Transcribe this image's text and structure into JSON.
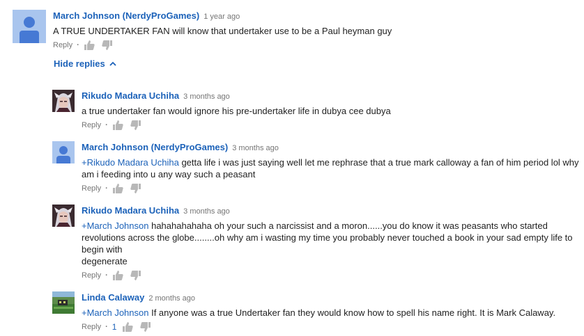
{
  "top_comment": {
    "author": "March Johnson (NerdyProGames)",
    "time": "1 year ago",
    "text": "A TRUE UNDERTAKER FAN will know that undertaker use to be a Paul heyman guy",
    "reply_label": "Reply",
    "avatar": "default-user-icon"
  },
  "hide_replies_label": "Hide replies",
  "replies": [
    {
      "author": "Rikudo Madara Uchiha",
      "time": "3 months ago",
      "mention": "",
      "text": "a true undertaker fan would ignore his pre-undertaker life in dubya cee dubya",
      "reply_label": "Reply",
      "avatar": "anime-character-photo"
    },
    {
      "author": "March Johnson (NerdyProGames)",
      "time": "3 months ago",
      "mention": "+Rikudo Madara Uchiha",
      "text": " getta life i was just saying well let me rephrase that a true mark calloway a fan of him period lol why am i feeding into u any way such a peasant",
      "reply_label": "Reply",
      "avatar": "default-user-icon"
    },
    {
      "author": "Rikudo Madara Uchiha",
      "time": "3 months ago",
      "mention": "+March Johnson",
      "text": " hahahahahaha oh your such a narcissist and a moron......you do know it was peasants who started revolutions across the globe........oh why am i wasting my time you probably never touched a book in your sad empty life to begin with",
      "text2": "degenerate",
      "reply_label": "Reply",
      "avatar": "anime-character-photo"
    },
    {
      "author": "Linda Calaway",
      "time": "2 months ago",
      "mention": "+March Johnson",
      "text": " If anyone was a true Undertaker fan they would know how to spell his name right. It is Mark Calaway.",
      "reply_label": "Reply",
      "likes": "1",
      "avatar": "landscape-photo"
    }
  ],
  "colors": {
    "link": "#1c62b9",
    "meta": "#767676",
    "text": "#222222",
    "avatar_bg": "#a9c5ee",
    "avatar_fg": "#4679d4"
  }
}
